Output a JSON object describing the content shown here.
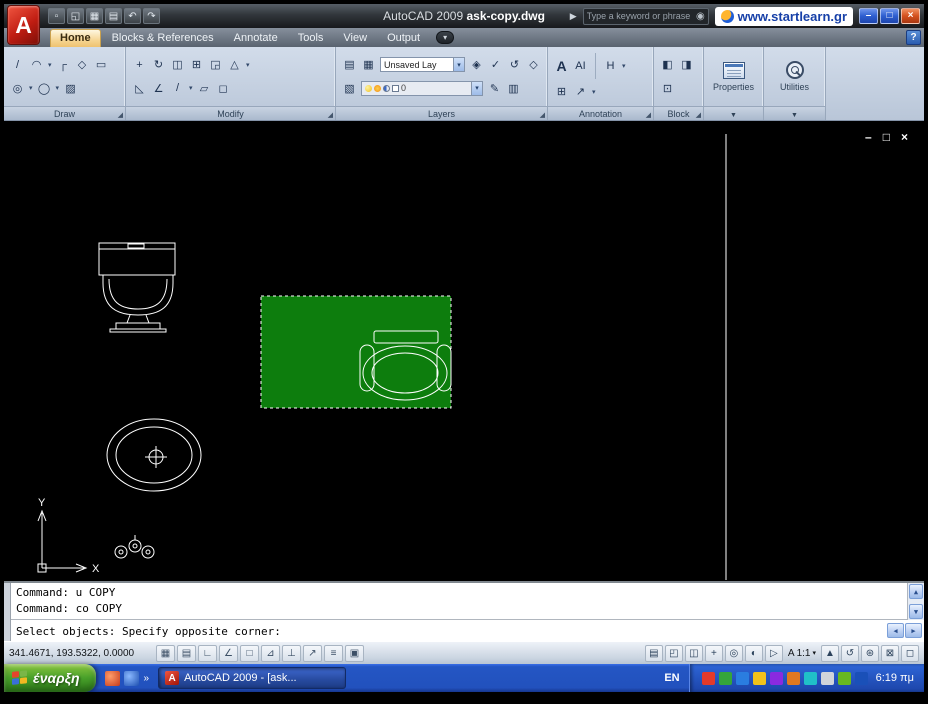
{
  "colors": {
    "selection_green": "#0d7d0d"
  },
  "title_bar": {
    "logo_letter": "A",
    "app_title": "AutoCAD 2009",
    "doc_name": "ask-copy.dwg",
    "go_arrow": "▶",
    "search_prompt": "Type a keyword or phrase",
    "binoculars": "◉",
    "watermark": "www.startlearn.gr",
    "minimize": "–",
    "restore": "□",
    "close": "×"
  },
  "qat": [
    {
      "name": "new",
      "glyph": "▫"
    },
    {
      "name": "open",
      "glyph": "◱"
    },
    {
      "name": "save",
      "glyph": "▦"
    },
    {
      "name": "plot",
      "glyph": "▤"
    },
    {
      "name": "undo",
      "glyph": "↶"
    },
    {
      "name": "redo",
      "glyph": "↷"
    }
  ],
  "tabs": [
    {
      "label": "Home"
    },
    {
      "label": "Blocks & References"
    },
    {
      "label": "Annotate"
    },
    {
      "label": "Tools"
    },
    {
      "label": "View"
    },
    {
      "label": "Output"
    }
  ],
  "help_button": "?",
  "ribbon": {
    "draw": {
      "label": "Draw",
      "icons1": [
        "/",
        "◠",
        "┌",
        "◇",
        "▭"
      ],
      "icons2": [
        "◎",
        "◯",
        "▨"
      ]
    },
    "modify": {
      "label": "Modify",
      "icons1": [
        "+",
        "↻",
        "◫",
        "⊞",
        "◲",
        "△"
      ],
      "icons2": [
        "◺",
        "∠",
        "/",
        "▱",
        "◻"
      ]
    },
    "layers": {
      "label": "Layers",
      "icons1": [
        "▤",
        "▦"
      ],
      "combo1": "Unsaved Lay",
      "icons1b": [
        "◈",
        "✓",
        "↺",
        "◇"
      ],
      "icons2": [
        "▧"
      ],
      "combo2_layer": "0",
      "icons2b": [
        "✎",
        "▥"
      ]
    },
    "annotation": {
      "label": "Annotation",
      "icons1": [
        "A",
        "AI",
        "H"
      ],
      "icons2": [
        "⊞",
        "↗"
      ]
    },
    "block": {
      "label": "Block",
      "icons1": [
        "◧",
        "◨"
      ],
      "icons2": [
        "⊡"
      ]
    },
    "properties": {
      "label": "Properties"
    },
    "utilities": {
      "label": "Utilities"
    }
  },
  "doc_window": {
    "minimize": "–",
    "restore": "□",
    "close": "×"
  },
  "drawing": {
    "axis_x": "X",
    "axis_y": "Y"
  },
  "command": {
    "line1": "Command: u COPY",
    "line2": "Command: co COPY",
    "prompt": "Select objects: Specify opposite corner:",
    "scroll_up": "▲",
    "scroll_down": "▼",
    "scroll_left": "◀",
    "scroll_right": "▶"
  },
  "status": {
    "coords": "341.4671, 193.5322, 0.0000",
    "toggles": [
      {
        "name": "snap",
        "glyph": "▦"
      },
      {
        "name": "grid",
        "glyph": "▤"
      },
      {
        "name": "ortho",
        "glyph": "∟"
      },
      {
        "name": "polar",
        "glyph": "∠"
      },
      {
        "name": "osnap",
        "glyph": "□"
      },
      {
        "name": "otrack",
        "glyph": "⊿"
      },
      {
        "name": "ducs",
        "glyph": "⊥"
      },
      {
        "name": "dyn",
        "glyph": "↗"
      },
      {
        "name": "lwt",
        "glyph": "≡"
      },
      {
        "name": "qp",
        "glyph": "▣"
      }
    ],
    "right1": [
      {
        "name": "model",
        "glyph": "▤"
      },
      {
        "name": "quick-view-layouts",
        "glyph": "◰"
      },
      {
        "name": "quick-view-drawings",
        "glyph": "◫"
      },
      {
        "name": "pan",
        "glyph": "+"
      },
      {
        "name": "zoom",
        "glyph": "◎"
      },
      {
        "name": "steering-wheel",
        "glyph": "◐"
      },
      {
        "name": "show-motion",
        "glyph": "▷"
      }
    ],
    "scale_icon": "A",
    "scale": "1:1",
    "right2": [
      {
        "name": "annotation-visibility",
        "glyph": "▲"
      },
      {
        "name": "annotation-autoscale",
        "glyph": "↺"
      },
      {
        "name": "workspace-switching",
        "glyph": "⊛"
      },
      {
        "name": "toolbar-lock",
        "glyph": "⊠"
      },
      {
        "name": "clean-screen",
        "glyph": "◻"
      }
    ]
  },
  "taskbar": {
    "start": "έναρξη",
    "more": "»",
    "task": "AutoCAD 2009 - [ask...",
    "lang": "EN",
    "time": "6:19 πμ"
  }
}
